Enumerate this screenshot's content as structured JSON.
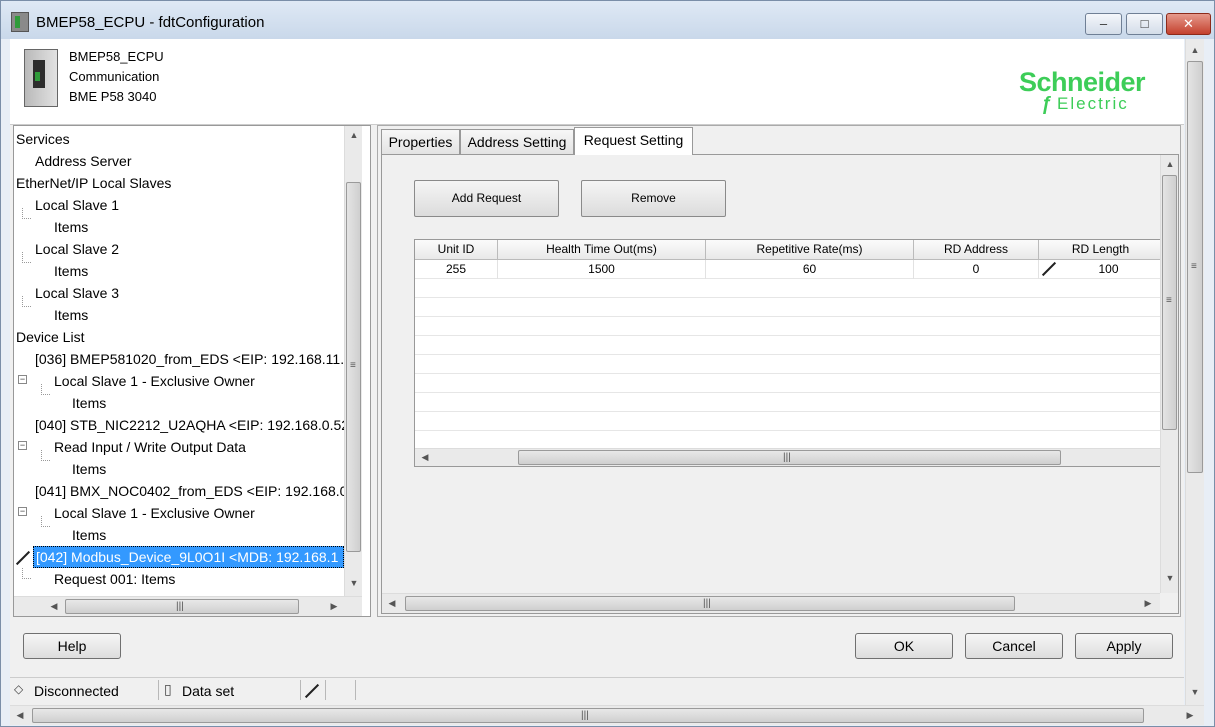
{
  "window": {
    "title": "BMEP58_ECPU - fdtConfiguration",
    "min_glyph": "–",
    "max_glyph": "□",
    "close_glyph": "✕"
  },
  "header": {
    "device_name": "BMEP58_ECPU",
    "category": "Communication",
    "model": "BME P58 3040",
    "logo_name": "Schneider",
    "logo_sub": "Electric",
    "logo_mark": "ƒ",
    "brand_color": "#3dcd58"
  },
  "tree": {
    "items": [
      {
        "label": "Services"
      },
      {
        "label": "Address Server"
      },
      {
        "label": "EtherNet/IP Local Slaves"
      },
      {
        "label": "Local Slave 1"
      },
      {
        "label": "Items"
      },
      {
        "label": "Local Slave 2"
      },
      {
        "label": "Items"
      },
      {
        "label": "Local Slave 3"
      },
      {
        "label": "Items"
      },
      {
        "label": "Device List"
      },
      {
        "label": "[036] BMEP581020_from_EDS <EIP: 192.168.11."
      },
      {
        "label": "Local Slave 1 - Exclusive Owner"
      },
      {
        "label": "Items"
      },
      {
        "label": "[040] STB_NIC2212_U2AQHA <EIP: 192.168.0.52"
      },
      {
        "label": "Read Input / Write Output Data"
      },
      {
        "label": "Items"
      },
      {
        "label": "[041] BMX_NOC0402_from_EDS <EIP: 192.168.0"
      },
      {
        "label": "Local Slave 1 - Exclusive Owner"
      },
      {
        "label": "Items"
      },
      {
        "label": "[042] Modbus_Device_9L0O1I <MDB: 192.168.1"
      },
      {
        "label": "Request 001: Items"
      }
    ],
    "collapse_glyph": "−"
  },
  "tabs": [
    {
      "label": "Properties"
    },
    {
      "label": "Address Setting"
    },
    {
      "label": "Request Setting"
    }
  ],
  "request_setting": {
    "add_request_label": "Add Request",
    "remove_label": "Remove",
    "columns": [
      "Unit ID",
      "Health Time Out(ms)",
      "Repetitive Rate(ms)",
      "RD Address",
      "RD Length"
    ],
    "rows": [
      {
        "unit_id": "255",
        "health_timeout": "1500",
        "repetitive_rate": "60",
        "rd_address": "0",
        "rd_length": "100"
      }
    ]
  },
  "scroll": {
    "up": "▲",
    "down": "▼",
    "left": "◀",
    "right": "▶",
    "grip_v": "≡",
    "grip_h": "|||"
  },
  "buttons": {
    "help": "Help",
    "ok": "OK",
    "cancel": "Cancel",
    "apply": "Apply"
  },
  "status": {
    "connection": "Disconnected",
    "dataset": "Data set",
    "connection_glyph": "◇",
    "dataset_glyph": "▯"
  }
}
